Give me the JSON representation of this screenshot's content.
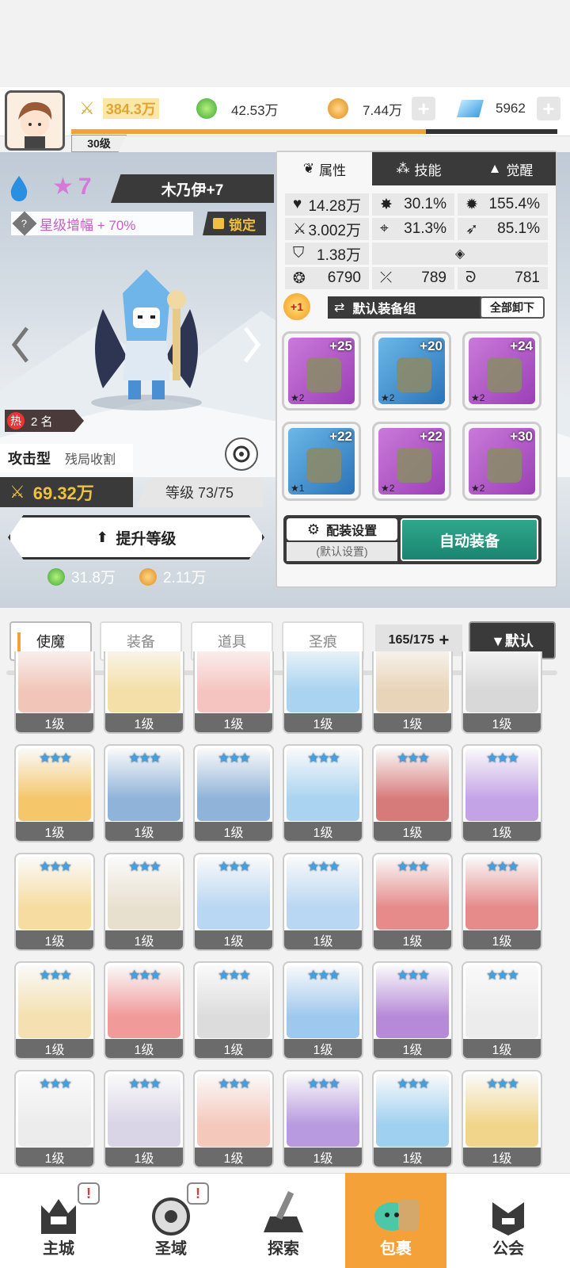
{
  "player": {
    "level": "30级",
    "xp_fraction": 0.73
  },
  "resources": {
    "power": "384.3万",
    "green": "42.53万",
    "gold": "7.44万",
    "gem": "5962"
  },
  "hero": {
    "star": "7",
    "name": "木乃伊+7",
    "star_bonus": "星级增幅 + 70%",
    "lock": "锁定",
    "hot_tag": "热",
    "rank": "2 名",
    "type": "攻击型",
    "subtype": "残局收割",
    "power": "69.32万",
    "level_label": "等级 73/75",
    "upgrade": "提升等级",
    "cost_green": "31.8万",
    "cost_gold": "2.11万"
  },
  "panel": {
    "tabs": [
      "属性",
      "技能",
      "觉醒"
    ],
    "stats": {
      "hp": "14.28万",
      "crit": "30.1%",
      "critdmg": "155.4%",
      "atk": "3.002万",
      "hit": "31.3%",
      "speed": "85.1%",
      "def": "1.38万",
      "s1": "6790",
      "s2": "789",
      "s3": "781"
    },
    "plus_badge": "+1",
    "equip_set": "默认装备组",
    "unequip_all": "全部卸下",
    "equipment": [
      {
        "plus": "+25",
        "stars": "★2",
        "rarity": "purple",
        "icon": "sword-icon"
      },
      {
        "plus": "+20",
        "stars": "★2",
        "rarity": "blue",
        "icon": "helmet-icon"
      },
      {
        "plus": "+24",
        "stars": "★2",
        "rarity": "purple",
        "icon": "armor-icon"
      },
      {
        "plus": "+22",
        "stars": "★1",
        "rarity": "blue",
        "icon": "belt-icon"
      },
      {
        "plus": "+22",
        "stars": "★2",
        "rarity": "purple",
        "icon": "necklace-icon"
      },
      {
        "plus": "+30",
        "stars": "★2",
        "rarity": "purple",
        "icon": "boots-icon"
      }
    ],
    "config": "配装设置",
    "config_sub": "(默认设置)",
    "auto_equip": "自动装备"
  },
  "filters": {
    "tabs": [
      "使魔",
      "装备",
      "道具",
      "圣痕"
    ],
    "count": "165/175",
    "sort": "▼默认"
  },
  "grid": {
    "level": "1级",
    "stars": "★★★",
    "colors": [
      "#f1c6b8",
      "#f4dfa8",
      "#f6c4c0",
      "#a9d3f0",
      "#e8d4b8",
      "#d8d8d8",
      "#f5c66a",
      "#8fb3d9",
      "#8fb3d9",
      "#a9d3f0",
      "#d77a7a",
      "#c3a3e6",
      "#f6dca0",
      "#e8e0cf",
      "#b9d6f2",
      "#b9d6f2",
      "#e68a8a",
      "#e68a8a",
      "#f4e0b0",
      "#f09a9a",
      "#dcdcdc",
      "#9fc8ee",
      "#b78ad9",
      "#ececec",
      "#ececec",
      "#d9d4e6",
      "#f5c8bc",
      "#b89ae0",
      "#9fd0f0",
      "#f1d58a"
    ]
  },
  "nav": {
    "items": [
      "主城",
      "圣域",
      "探索",
      "包裹",
      "公会"
    ]
  }
}
